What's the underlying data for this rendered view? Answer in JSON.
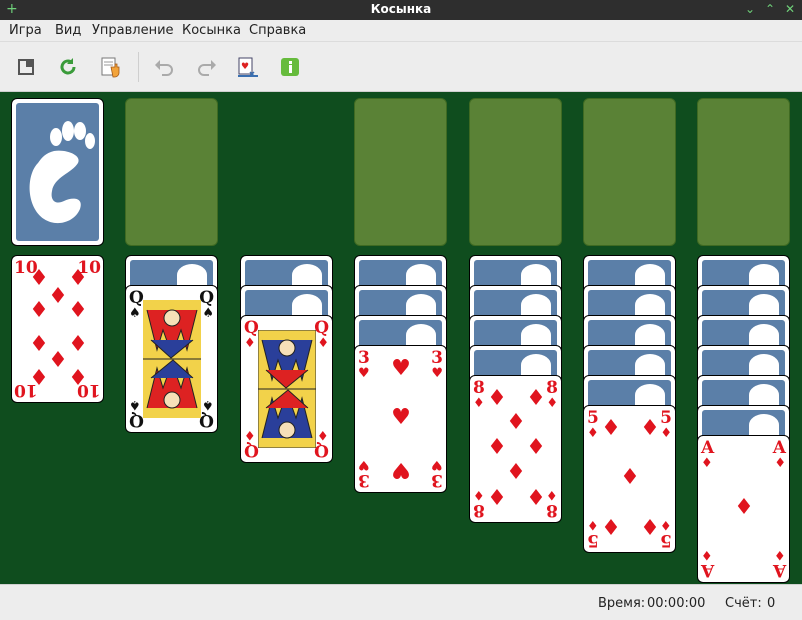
{
  "window": {
    "title": "Косынка",
    "pin_icon": "pin-icon",
    "minimize_icon": "minimize-icon",
    "maximize_icon": "maximize-icon",
    "close_icon": "close-icon"
  },
  "menu": [
    {
      "label": "Игра"
    },
    {
      "label": "Вид"
    },
    {
      "label": "Управление"
    },
    {
      "label": "Косынка"
    },
    {
      "label": "Справка"
    }
  ],
  "toolbar": [
    {
      "icon": "fullscreen-icon",
      "enabled": true
    },
    {
      "icon": "restart-icon",
      "enabled": true
    },
    {
      "icon": "hint-icon",
      "enabled": true
    },
    {
      "icon": "undo-icon",
      "enabled": false
    },
    {
      "icon": "redo-icon",
      "enabled": false
    },
    {
      "icon": "deal-icon",
      "enabled": true
    },
    {
      "icon": "info-icon",
      "enabled": true
    }
  ],
  "board": {
    "stock": {
      "face_down": true,
      "logo": "gnome-foot-logo"
    },
    "foundations": [
      {
        "empty": true
      },
      {
        "empty": true
      },
      {
        "empty": true
      },
      {
        "empty": true
      }
    ],
    "tableau": [
      {
        "hidden": 0,
        "top": {
          "rank": "10",
          "suit": "♦",
          "color": "red"
        }
      },
      {
        "hidden": 1,
        "top": {
          "rank": "Q",
          "suit": "♠",
          "color": "black"
        }
      },
      {
        "hidden": 2,
        "top": {
          "rank": "Q",
          "suit": "♦",
          "color": "red"
        }
      },
      {
        "hidden": 3,
        "top": {
          "rank": "3",
          "suit": "♥",
          "color": "red"
        }
      },
      {
        "hidden": 4,
        "top": {
          "rank": "8",
          "suit": "♦",
          "color": "red"
        }
      },
      {
        "hidden": 5,
        "top": {
          "rank": "5",
          "suit": "♦",
          "color": "red"
        }
      },
      {
        "hidden": 6,
        "top": {
          "rank": "A",
          "suit": "♦",
          "color": "red"
        }
      }
    ]
  },
  "status": {
    "time_label": "Время:",
    "time_value": "00:00:00",
    "score_label": "Счёт:",
    "score_value": "0"
  }
}
